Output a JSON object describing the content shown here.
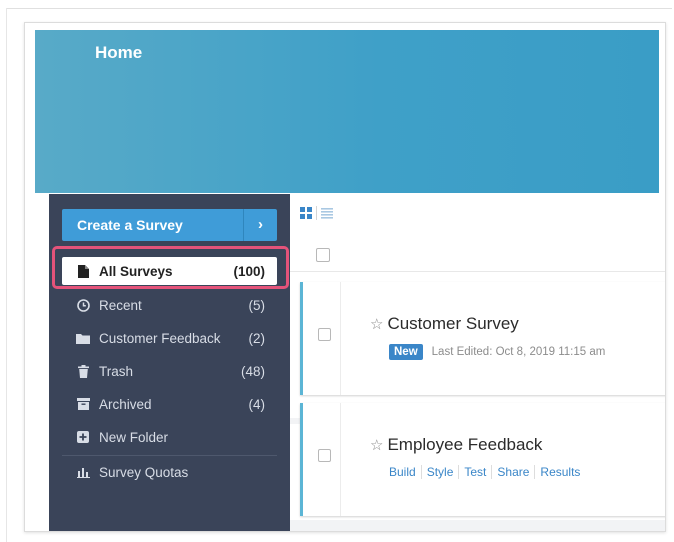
{
  "banner": {
    "title": "Home"
  },
  "sidebar": {
    "create_label": "Create a Survey",
    "create_arrow": "›",
    "items": [
      {
        "icon": "file-icon",
        "label": "All Surveys",
        "count": "(100)",
        "active": true
      },
      {
        "icon": "clock-icon",
        "label": "Recent",
        "count": "(5)"
      },
      {
        "icon": "folder-icon",
        "label": "Customer Feedback",
        "count": "(2)"
      },
      {
        "icon": "trash-icon",
        "label": "Trash",
        "count": "(48)"
      },
      {
        "icon": "archive-icon",
        "label": "Archived",
        "count": "(4)"
      },
      {
        "icon": "plus-square-icon",
        "label": "New Folder",
        "count": ""
      },
      {
        "icon": "bar-chart-icon",
        "label": "Survey Quotas",
        "count": ""
      }
    ]
  },
  "toolbar": {
    "grid_icon": "grid-view-icon",
    "list_icon": "list-view-icon"
  },
  "surveys": [
    {
      "title": "Customer Survey",
      "badge": "New",
      "edited": "Last Edited: Oct 8, 2019 11:15 am"
    },
    {
      "title": "Employee Feedback",
      "actions": [
        "Build",
        "Style",
        "Test",
        "Share",
        "Results"
      ]
    }
  ],
  "colors": {
    "banner": "#3fa0c8",
    "sidebar": "#3a4459",
    "accent": "#3f9cd8",
    "highlight": "#e4537a",
    "link": "#3a86c8"
  }
}
